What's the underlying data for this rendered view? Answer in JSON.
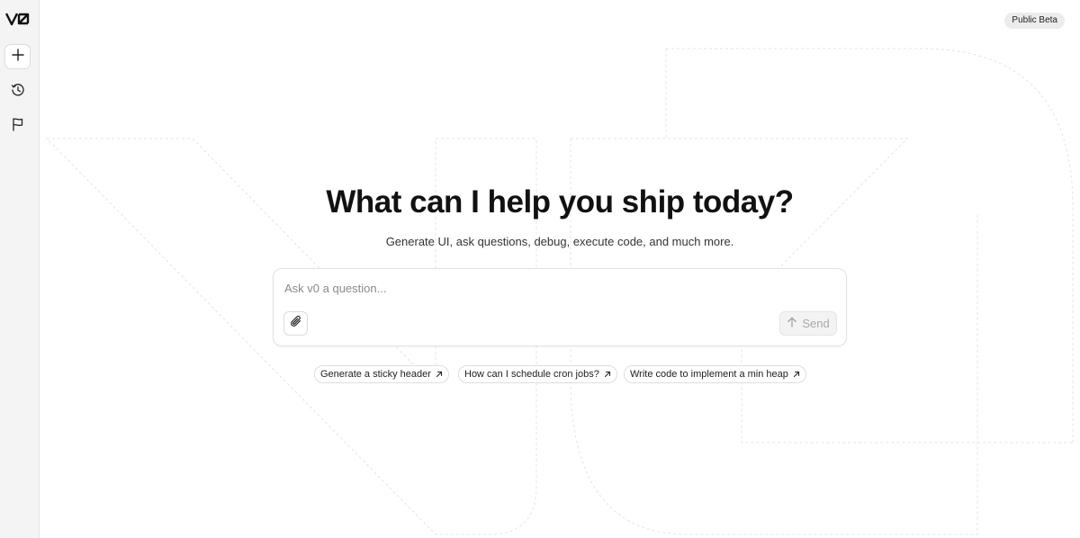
{
  "app": {
    "logo": "v0",
    "badge": "Public Beta"
  },
  "sidebar": {
    "items": [
      {
        "name": "new-chat",
        "icon": "plus-icon"
      },
      {
        "name": "history",
        "icon": "history-clock-icon"
      },
      {
        "name": "feedback",
        "icon": "flag-icon"
      }
    ]
  },
  "main": {
    "headline": "What can I help you ship today?",
    "subheadline": "Generate UI, ask questions, debug, execute code, and much more."
  },
  "prompt": {
    "placeholder": "Ask v0 a question...",
    "value": "",
    "attach_icon": "paperclip-icon",
    "send_label": "Send",
    "send_icon": "arrow-up-icon"
  },
  "suggestions": [
    {
      "label": "Generate a sticky header",
      "icon": "arrow-up-right-icon"
    },
    {
      "label": "How can I schedule cron jobs?",
      "icon": "arrow-up-right-icon"
    },
    {
      "label": "Write code to implement a min heap",
      "icon": "arrow-up-right-icon"
    }
  ],
  "colors": {
    "text": "#111111",
    "muted": "#8a8a8a",
    "border": "#e2e2e2",
    "sidebar_bg": "#f4f4f4",
    "badge_bg": "#ececec"
  }
}
